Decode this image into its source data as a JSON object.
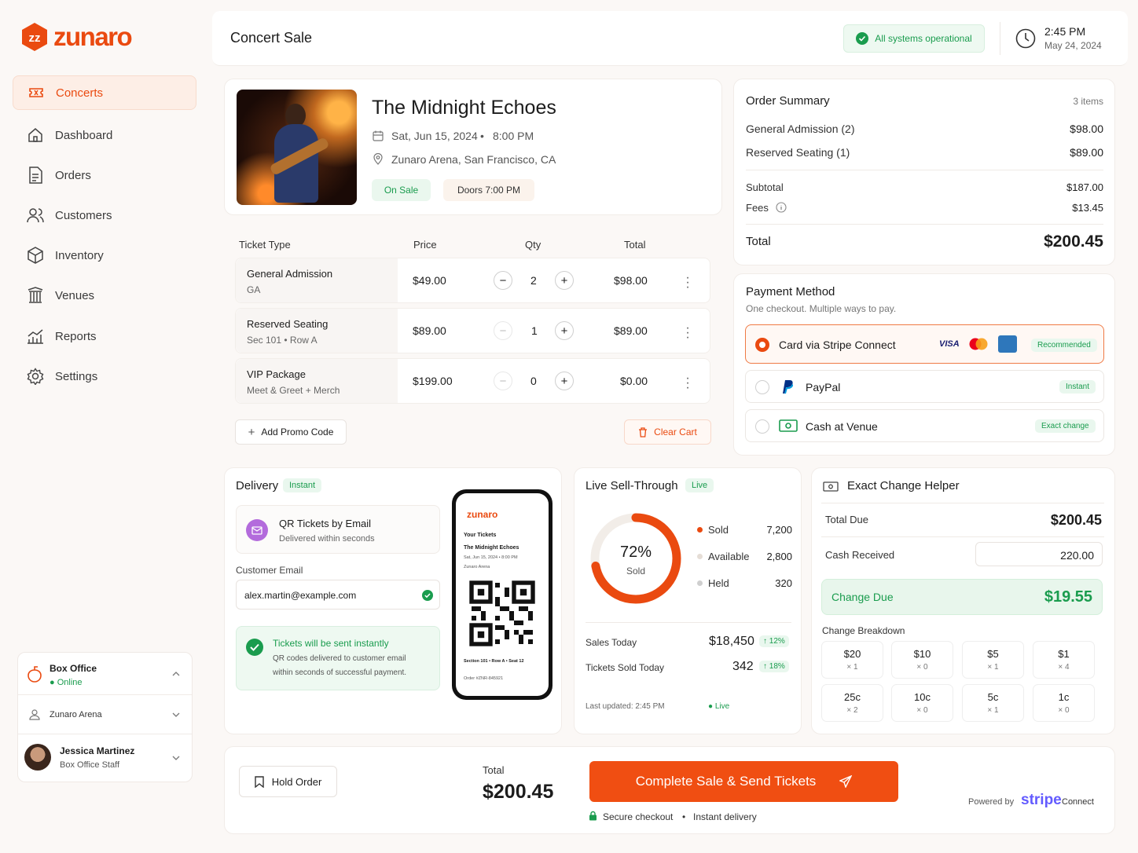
{
  "brand": {
    "name": "zunaro",
    "accent": "#ea4a10",
    "success": "#1a9c4e"
  },
  "sidebar": {
    "items": [
      {
        "label": "Concerts",
        "icon": "ticket-icon"
      },
      {
        "label": "Dashboard",
        "icon": "home-icon"
      },
      {
        "label": "Orders",
        "icon": "document-icon"
      },
      {
        "label": "Customers",
        "icon": "users-icon"
      },
      {
        "label": "Inventory",
        "icon": "box-icon"
      },
      {
        "label": "Venues",
        "icon": "building-icon"
      },
      {
        "label": "Reports",
        "icon": "chart-icon"
      },
      {
        "label": "Settings",
        "icon": "gear-icon"
      }
    ],
    "box_office": {
      "title": "Box Office",
      "status": "● Online"
    },
    "venue": "Zunaro Arena",
    "user": {
      "name": "Jessica Martinez",
      "role": "Box Office Staff"
    }
  },
  "header": {
    "title": "Concert Sale",
    "status": "All systems operational",
    "time": "2:45 PM",
    "date": "May 24, 2024"
  },
  "event": {
    "title": "The Midnight Echoes",
    "date": "Sat, Jun 15, 2024",
    "sep": "•",
    "time": "8:00 PM",
    "venue": "Zunaro Arena, San Francisco, CA",
    "status": "On Sale",
    "doors": "Doors 7:00 PM"
  },
  "tickets": {
    "headers": {
      "type": "Ticket Type",
      "price": "Price",
      "qty": "Qty",
      "total": "Total"
    },
    "rows": [
      {
        "name": "General Admission",
        "sub": "GA",
        "price": "$49.00",
        "qty": "2",
        "total": "$98.00"
      },
      {
        "name": "Reserved Seating",
        "sub": "Sec 101  •  Row A",
        "price": "$89.00",
        "qty": "1",
        "total": "$89.00"
      },
      {
        "name": "VIP Package",
        "sub": "Meet & Greet + Merch",
        "price": "$199.00",
        "qty": "0",
        "total": "$0.00"
      }
    ],
    "add_promo": "Add Promo Code",
    "clear_cart": "Clear Cart"
  },
  "summary": {
    "title": "Order Summary",
    "count": "3 items",
    "lines": [
      {
        "label": "General Admission (2)",
        "value": "$98.00"
      },
      {
        "label": "Reserved Seating (1)",
        "value": "$89.00"
      }
    ],
    "subtotal_label": "Subtotal",
    "subtotal": "$187.00",
    "fees_label": "Fees",
    "fees": "$13.45",
    "total_label": "Total",
    "total": "$200.45"
  },
  "payment": {
    "title": "Payment Method",
    "subtitle": "One checkout. Multiple ways to pay.",
    "options": [
      {
        "label": "Card via Stripe Connect",
        "badge": "Recommended",
        "visa": "VISA"
      },
      {
        "label": "PayPal",
        "badge": "Instant"
      },
      {
        "label": "Cash at Venue",
        "badge": "Exact change"
      }
    ]
  },
  "delivery": {
    "title": "Delivery",
    "badge": "Instant",
    "method_title": "QR Tickets by Email",
    "method_sub": "Delivered within seconds",
    "email_label": "Customer Email",
    "email": "alex.martin@example.com",
    "notice_title": "Tickets will be sent instantly",
    "notice_body_1": "QR codes delivered to customer email",
    "notice_body_2": "within seconds of successful payment.",
    "phone": {
      "brand": "zunaro",
      "heading": "Your Tickets",
      "event": "The Midnight Echoes",
      "when": "Sat, Jun 15, 2024 • 8:00 PM",
      "venue": "Zunaro Arena",
      "seat": "Section 101 • Row A • Seat 12",
      "order": "Order #ZNR-845921"
    }
  },
  "sell": {
    "title": "Live Sell-Through",
    "badge": "Live",
    "percent": "72%",
    "percent_label": "Sold",
    "percent_value": 0.72,
    "legend": [
      {
        "label": "Sold",
        "value": "7,200",
        "color": "#ea4a10"
      },
      {
        "label": "Available",
        "value": "2,800",
        "color": "#e5ddd6"
      },
      {
        "label": "Held",
        "value": "320",
        "color": "#cfcfcf"
      }
    ],
    "sales_label": "Sales Today",
    "sales": "$18,450",
    "sales_change": "↑ 12%",
    "sold_label": "Tickets Sold Today",
    "sold": "342",
    "sold_change": "↑ 18%",
    "updated": "Last updated: 2:45 PM",
    "live": "● Live"
  },
  "change": {
    "title": "Exact Change Helper",
    "due_label": "Total Due",
    "due": "$200.45",
    "received_label": "Cash Received",
    "received": "220.00",
    "change_label": "Change Due",
    "change": "$19.55",
    "breakdown_title": "Change Breakdown",
    "denoms": [
      {
        "v": "$20",
        "c": "× 1"
      },
      {
        "v": "$10",
        "c": "× 0"
      },
      {
        "v": "$5",
        "c": "× 1"
      },
      {
        "v": "$1",
        "c": "× 4"
      },
      {
        "v": "25c",
        "c": "× 2"
      },
      {
        "v": "10c",
        "c": "× 0"
      },
      {
        "v": "5c",
        "c": "× 1"
      },
      {
        "v": "1c",
        "c": "× 0"
      }
    ]
  },
  "footer": {
    "hold": "Hold Order",
    "total_label": "Total",
    "total": "$200.45",
    "cta": "Complete Sale & Send Tickets",
    "secure": "Secure checkout",
    "sep": "•",
    "instant": "Instant delivery",
    "powered": "Powered by",
    "stripe": "stripe",
    "connect": "Connect"
  }
}
